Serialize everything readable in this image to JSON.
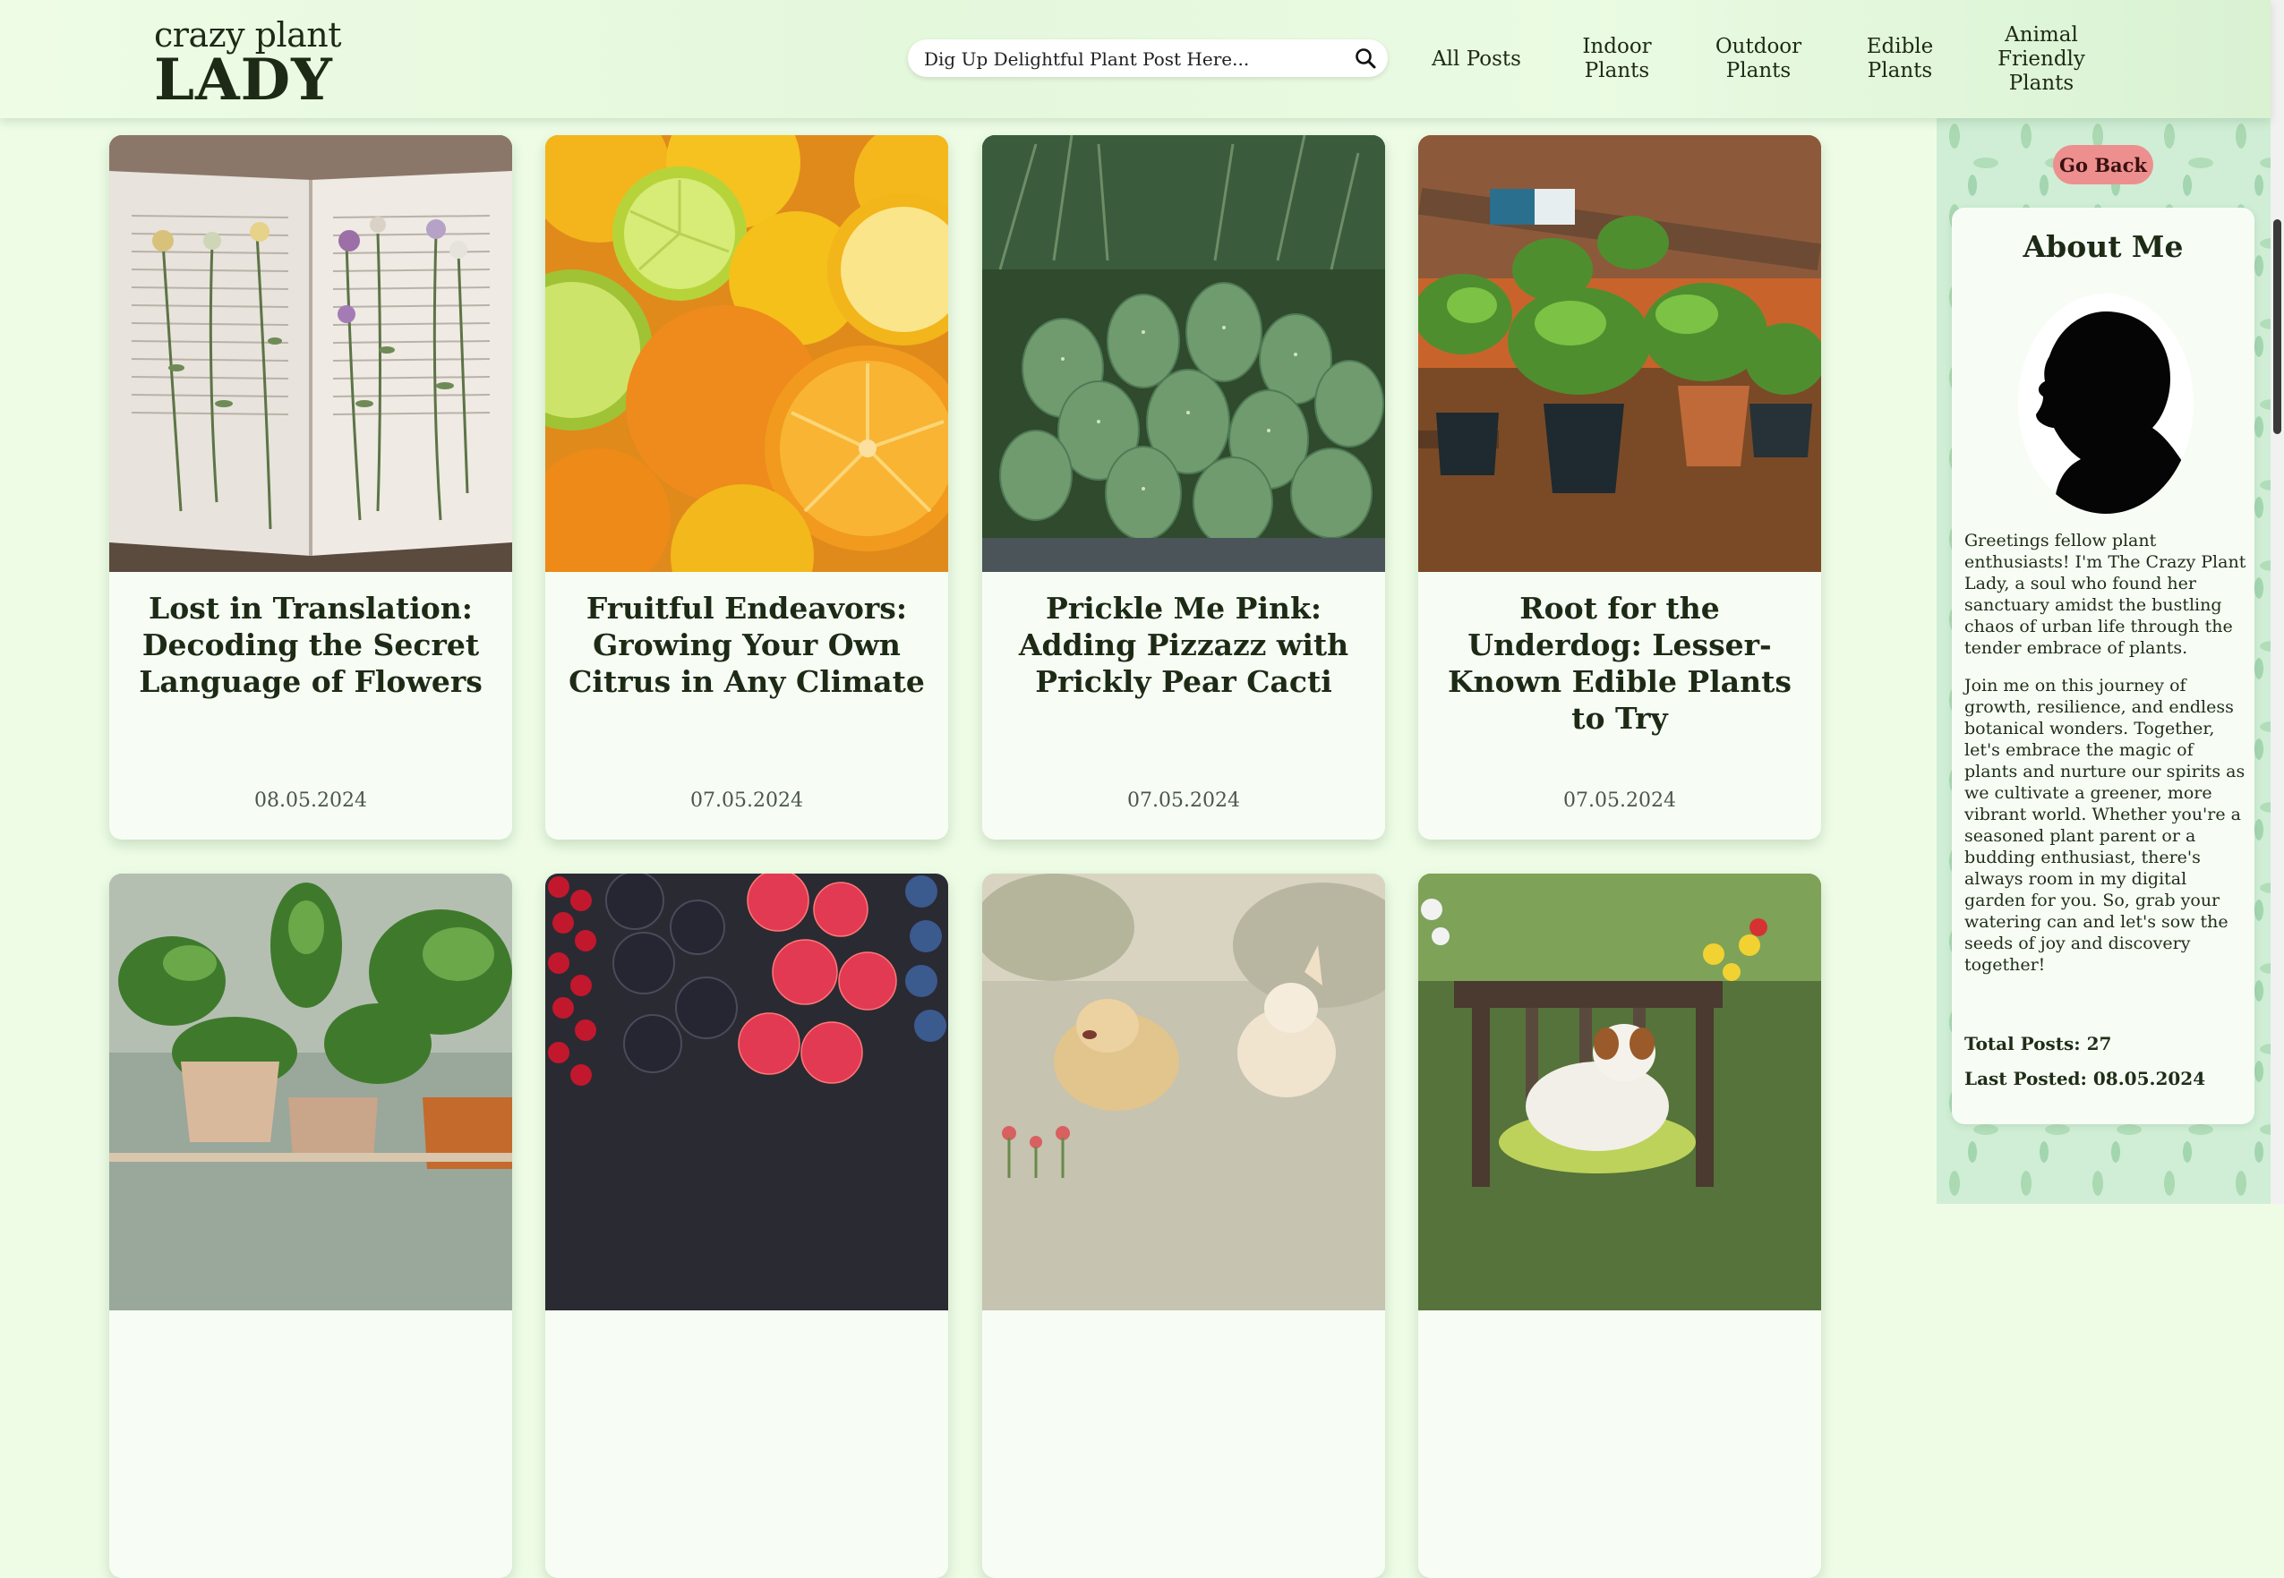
{
  "logo": {
    "line1": "crazy plant",
    "line2": "LADY"
  },
  "search": {
    "placeholder": "Dig Up Delightful Plant Post Here...",
    "icon": "search-icon"
  },
  "nav": [
    {
      "label": "All Posts"
    },
    {
      "label": "Indoor\nPlants"
    },
    {
      "label": "Outdoor\nPlants"
    },
    {
      "label": "Edible\nPlants"
    },
    {
      "label": "Animal\nFriendly\nPlants"
    }
  ],
  "sidebar": {
    "go_back": "Go Back",
    "about_title": "About Me",
    "about_p1": "Greetings fellow plant enthusiasts! I'm The Crazy Plant Lady, a soul who found her sanctuary amidst the bustling chaos of urban life through the tender embrace of plants.",
    "about_p2": "Join me on this journey of growth, resilience, and endless botanical wonders. Together, let's embrace the magic of plants and nurture our spirits as we cultivate a greener, more vibrant world. Whether you're a seasoned plant parent or a budding enthusiast, there's always room in my digital garden for you. So, grab your watering can and let's sow the seeds of joy and discovery together!",
    "total_posts": "Total Posts: 27",
    "last_posted": "Last Posted: 08.05.2024"
  },
  "posts": [
    {
      "title": "Lost in Translation: Decoding the Secret Language of Flowers",
      "date": "08.05.2024",
      "image": "pressed-flowers-book"
    },
    {
      "title": "Fruitful Endeavors: Growing Your Own Citrus in Any Climate",
      "date": "07.05.2024",
      "image": "citrus-fruits"
    },
    {
      "title": "Prickle Me Pink: Adding Pizzazz with Prickly Pear Cacti",
      "date": "07.05.2024",
      "image": "prickly-pear-cacti"
    },
    {
      "title": "Root for the Underdog: Lesser-Known Edible Plants to Try",
      "date": "07.05.2024",
      "image": "potted-herbs-shelf"
    },
    {
      "title": "",
      "date": "",
      "image": "indoor-potted-plants"
    },
    {
      "title": "",
      "date": "",
      "image": "mixed-berries"
    },
    {
      "title": "",
      "date": "",
      "image": "running-dogs"
    },
    {
      "title": "",
      "date": "",
      "image": "dog-on-garden-bench"
    }
  ],
  "colors": {
    "background": "#eefce6",
    "go_back": "#ee8f8f",
    "text_dark": "#1d2a15"
  }
}
